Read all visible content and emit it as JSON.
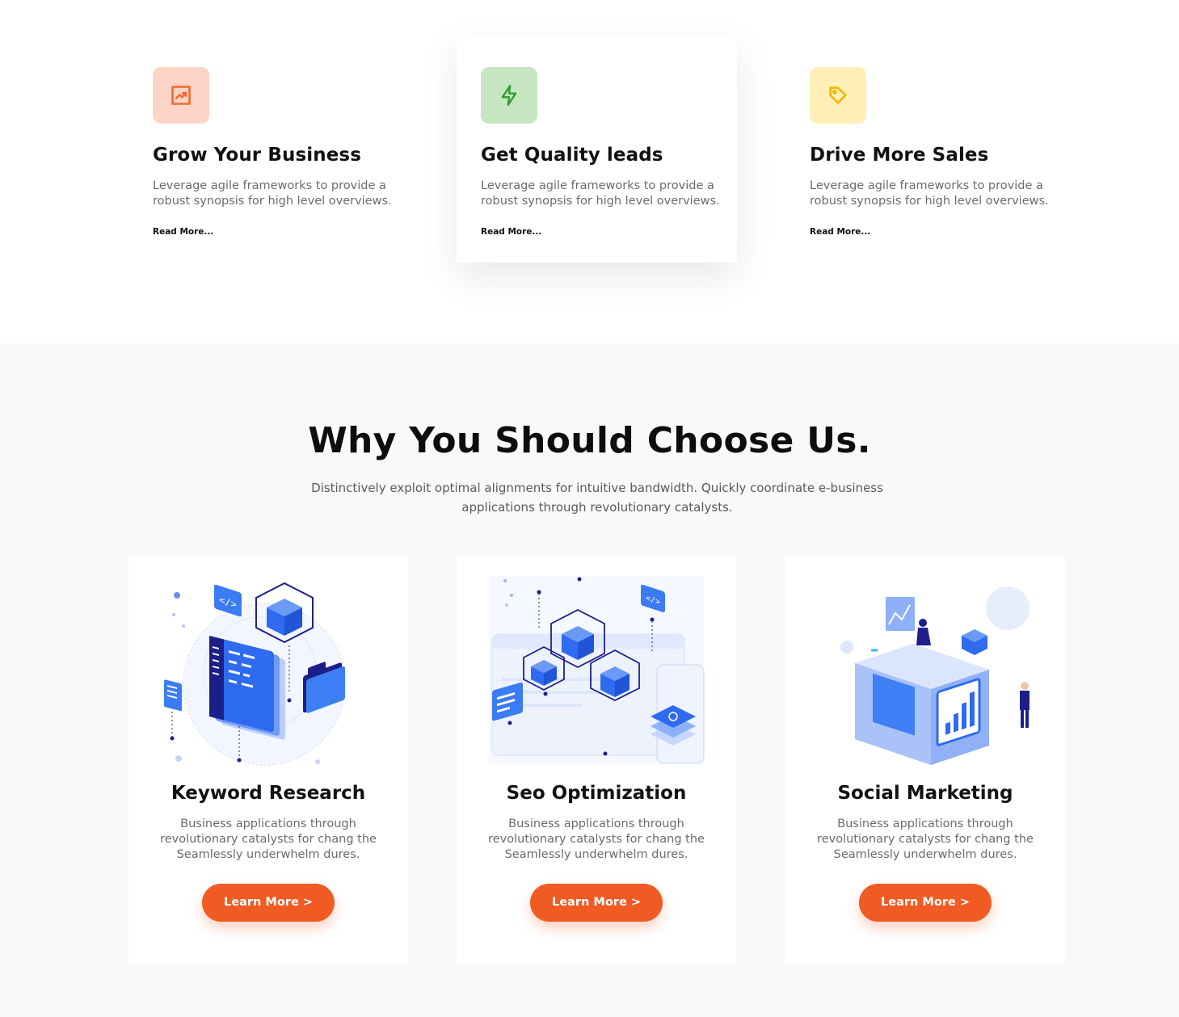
{
  "features": [
    {
      "icon": "trending-up-icon",
      "color": "#f26a2e",
      "bg": "#fdd4c6",
      "title": "Grow Your Business",
      "desc": "Leverage agile frameworks to provide a robust synopsis for high level overviews.",
      "link": "Read More..."
    },
    {
      "icon": "bolt-icon",
      "color": "#2e9a2e",
      "bg": "#c5e6c1",
      "title": "Get Quality leads",
      "desc": "Leverage agile frameworks to provide a robust synopsis for high level overviews.",
      "link": "Read More..."
    },
    {
      "icon": "tag-icon",
      "color": "#f2b400",
      "bg": "#fff0b8",
      "title": "Drive More Sales",
      "desc": "Leverage agile frameworks to provide a robust synopsis for high level overviews.",
      "link": "Read More..."
    }
  ],
  "why": {
    "title": "Why You Should Choose Us.",
    "lead": "Distinctively exploit optimal alignments for intuitive bandwidth. Quickly coordinate e-business applications through revolutionary catalysts."
  },
  "services": [
    {
      "illustration": "keyword-research-illustration",
      "title": "Keyword Research",
      "desc": "Business applications through revolutionary catalysts for chang the Seamlessly underwhelm dures.",
      "button": "Learn More >"
    },
    {
      "illustration": "seo-optimization-illustration",
      "title": "Seo Optimization",
      "desc": "Business applications through revolutionary catalysts for chang the Seamlessly underwhelm dures.",
      "button": "Learn More >"
    },
    {
      "illustration": "social-marketing-illustration",
      "title": "Social Marketing",
      "desc": "Business applications through revolutionary catalysts for chang the Seamlessly underwhelm dures.",
      "button": "Learn More >"
    }
  ],
  "colors": {
    "accent": "#f05a23",
    "section_bg": "#f9f9f9",
    "illus_blue": "#2f6bf0",
    "illus_navy": "#1c1f8a"
  }
}
